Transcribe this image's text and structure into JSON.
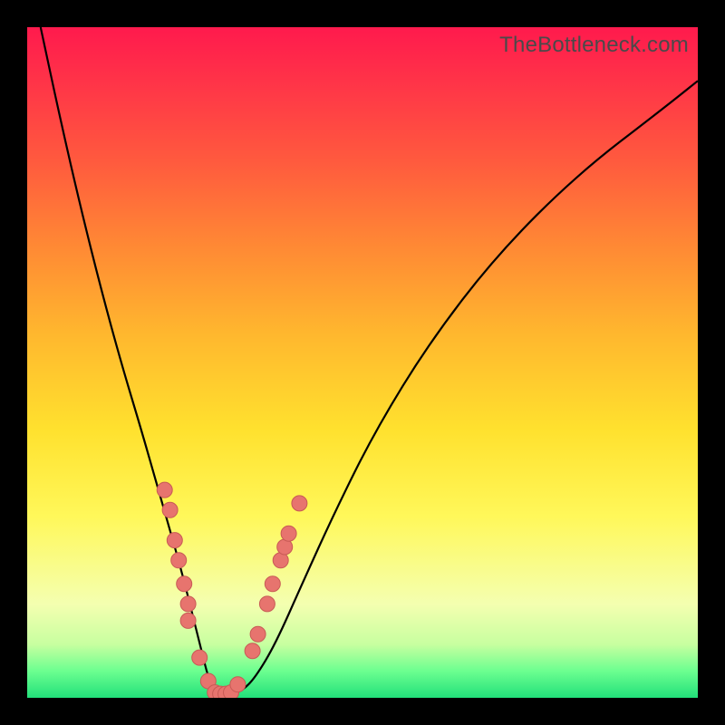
{
  "watermark": "TheBottleneck.com",
  "colors": {
    "gradient_top": "#ff1a4d",
    "gradient_bottom": "#22e07a",
    "curve": "#000000",
    "dot_fill": "#e7746e",
    "dot_stroke": "#c85a55",
    "frame": "#000000"
  },
  "chart_data": {
    "type": "line",
    "title": "",
    "xlabel": "",
    "ylabel": "",
    "xlim": [
      0,
      100
    ],
    "ylim": [
      0,
      100
    ],
    "series": [
      {
        "name": "bottleneck-curve",
        "x": [
          2,
          5,
          8,
          11,
          14,
          17,
          19,
          21,
          23,
          25,
          26,
          27,
          28,
          29,
          30,
          32,
          34,
          37,
          41,
          46,
          52,
          60,
          70,
          82,
          95,
          100
        ],
        "y": [
          100,
          86,
          73,
          61,
          50,
          40,
          33,
          26,
          19,
          11,
          7,
          3,
          1,
          0.5,
          0.5,
          1,
          3,
          8,
          17,
          28,
          40,
          53,
          66,
          78,
          88,
          92
        ]
      }
    ],
    "markers": [
      {
        "x": 20.5,
        "y": 31
      },
      {
        "x": 21.3,
        "y": 28
      },
      {
        "x": 22.0,
        "y": 23.5
      },
      {
        "x": 22.6,
        "y": 20.5
      },
      {
        "x": 23.4,
        "y": 17
      },
      {
        "x": 24.0,
        "y": 14
      },
      {
        "x": 24.0,
        "y": 11.5
      },
      {
        "x": 25.7,
        "y": 6
      },
      {
        "x": 27.0,
        "y": 2.5
      },
      {
        "x": 28.0,
        "y": 0.8
      },
      {
        "x": 28.8,
        "y": 0.6
      },
      {
        "x": 29.6,
        "y": 0.6
      },
      {
        "x": 30.4,
        "y": 0.8
      },
      {
        "x": 31.4,
        "y": 2.0
      },
      {
        "x": 33.6,
        "y": 7.0
      },
      {
        "x": 34.4,
        "y": 9.5
      },
      {
        "x": 35.8,
        "y": 14
      },
      {
        "x": 36.6,
        "y": 17
      },
      {
        "x": 37.8,
        "y": 20.5
      },
      {
        "x": 38.4,
        "y": 22.5
      },
      {
        "x": 39.0,
        "y": 24.5
      },
      {
        "x": 40.6,
        "y": 29
      }
    ]
  }
}
